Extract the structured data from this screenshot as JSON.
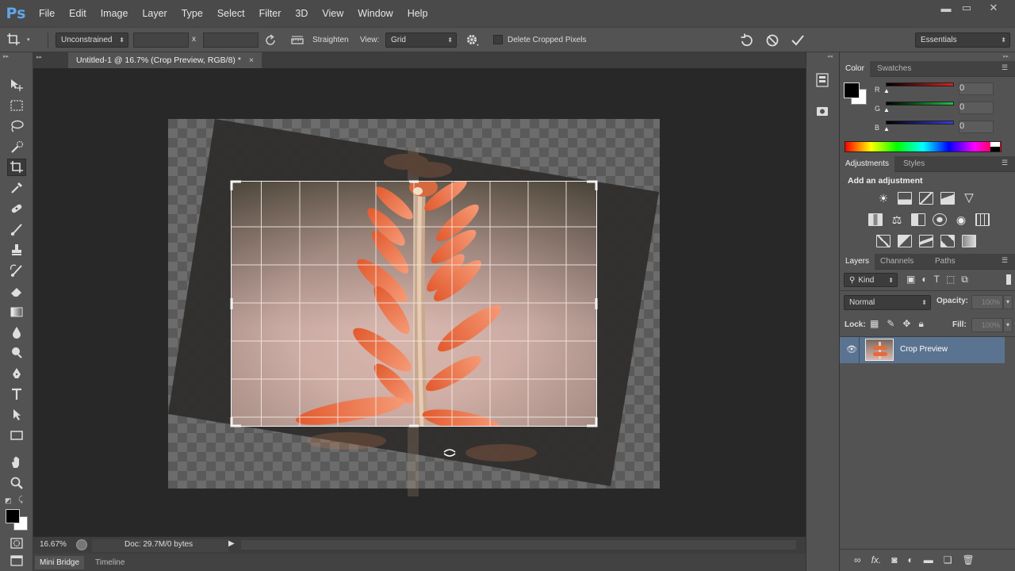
{
  "app": {
    "logo": "Ps",
    "accent": "#5fa6e8"
  },
  "menu": [
    "File",
    "Edit",
    "Image",
    "Layer",
    "Type",
    "Select",
    "Filter",
    "3D",
    "View",
    "Window",
    "Help"
  ],
  "window_controls": {
    "minimize": "▬",
    "restore": "▭",
    "close": "✕"
  },
  "options": {
    "ratio": "Unconstrained",
    "x_separator": "x",
    "width_value": "",
    "height_value": "",
    "straighten": "Straighten",
    "view_label": "View:",
    "view_value": "Grid",
    "delete_cropped": "Delete Cropped Pixels",
    "delete_cropped_checked": false,
    "workspace": "Essentials"
  },
  "document": {
    "tab_title": "Untitled-1 @ 16.7% (Crop Preview, RGB/8) *",
    "tab_close": "×"
  },
  "status": {
    "zoom": "16.67%",
    "doc_info": "Doc: 29.7M/0 bytes"
  },
  "bottom_tabs": [
    "Mini Bridge",
    "Timeline"
  ],
  "panels": {
    "color": {
      "tabs": [
        "Color",
        "Swatches"
      ],
      "channels": [
        {
          "label": "R",
          "value": "0",
          "color": "#e02020"
        },
        {
          "label": "G",
          "value": "0",
          "color": "#20c040"
        },
        {
          "label": "B",
          "value": "0",
          "color": "#3a3ae0"
        }
      ]
    },
    "adjustments": {
      "tabs": [
        "Adjustments",
        "Styles"
      ],
      "header": "Add an adjustment"
    },
    "layers": {
      "tabs": [
        "Layers",
        "Channels",
        "Paths"
      ],
      "filter_kind": "Kind",
      "blend_mode": "Normal",
      "opacity_label": "Opacity:",
      "opacity_value": "100%",
      "lock_label": "Lock:",
      "fill_label": "Fill:",
      "fill_value": "100%",
      "items": [
        {
          "name": "Crop Preview",
          "visible": true,
          "selected": true
        }
      ]
    }
  },
  "colors": {
    "foreground": "#000000",
    "background": "#ffffff",
    "selected_layer": "#5a7390"
  }
}
